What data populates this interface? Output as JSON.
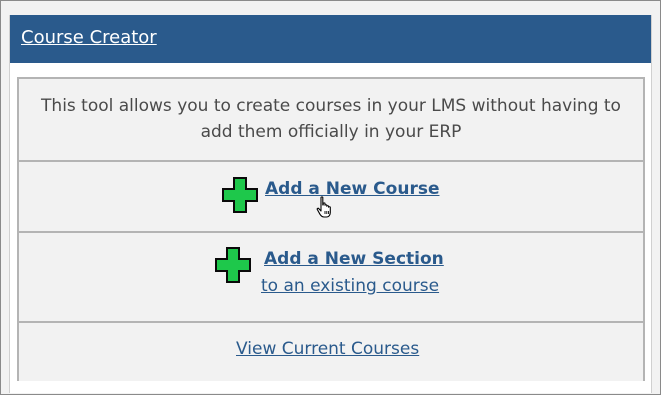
{
  "header": {
    "title": "Course Creator"
  },
  "intro": {
    "text": "This tool allows you to create courses in your LMS without having to add them officially in your ERP"
  },
  "actions": {
    "add_course_label": "Add a New Course",
    "add_section_label": "Add a New Section",
    "add_section_sublabel": "to an existing course",
    "view_courses_label": "View Current Courses"
  },
  "icons": {
    "add": "plus-icon",
    "cursor": "hand-pointer-icon"
  },
  "colors": {
    "header_bg": "#2a5a8c",
    "link": "#2a5a8c",
    "plus_fill": "#1ec84b"
  }
}
